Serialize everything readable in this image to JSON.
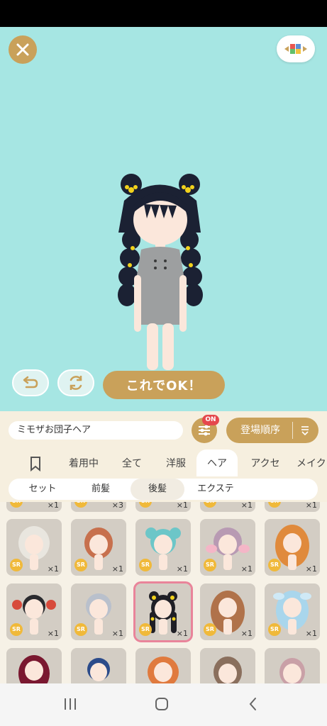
{
  "header": {
    "close_icon": "close-icon",
    "palette_icon": "palette-icon"
  },
  "avatar": {
    "hair_color": "#1b2133",
    "flower_color": "#f2d21c",
    "outfit_color": "#9d9fa0"
  },
  "controls": {
    "undo_icon": "undo-icon",
    "rotate_icon": "rotate-icon",
    "ok_label": "これでOK！"
  },
  "search": {
    "item_name": "ミモザお団子ヘア",
    "filter_badge": "ON",
    "sort_label": "登場順序"
  },
  "tabs": [
    {
      "label": ""
    },
    {
      "label": "着用中"
    },
    {
      "label": "全て"
    },
    {
      "label": "洋服"
    },
    {
      "label": "ヘア"
    },
    {
      "label": "アクセ"
    },
    {
      "label": "メイク"
    }
  ],
  "subtabs": [
    {
      "label": "セット"
    },
    {
      "label": "前髪"
    },
    {
      "label": "後髪"
    },
    {
      "label": "エクステ"
    }
  ],
  "grid": {
    "row0": [
      {
        "count": "×1"
      },
      {
        "count": "×3"
      },
      {
        "count": "×1"
      },
      {
        "count": "×1"
      },
      {
        "count": "×1"
      }
    ],
    "row1": [
      {
        "rarity": "SR",
        "count": "×1",
        "hair": "#e9e6df"
      },
      {
        "rarity": "SR",
        "count": "×1",
        "hair": "#c7704d"
      },
      {
        "rarity": "SR",
        "count": "×1",
        "hair": "#6cc6c8"
      },
      {
        "rarity": "SR",
        "count": "×1",
        "hair": "#b89ab3"
      },
      {
        "rarity": "SR",
        "count": "×1",
        "hair": "#e08a3c"
      }
    ],
    "row2": [
      {
        "rarity": "SR",
        "count": "×1",
        "hair": "#2a2a2e"
      },
      {
        "rarity": "SR",
        "count": "×1",
        "hair": "#b9c0cc"
      },
      {
        "rarity": "SR",
        "count": "×1",
        "hair": "#1f1f26"
      },
      {
        "rarity": "SR",
        "count": "×1",
        "hair": "#b0724a"
      },
      {
        "rarity": "SR",
        "count": "×1",
        "hair": "#a9d6ec"
      }
    ],
    "row3": [
      {
        "hair": "#7a1830"
      },
      {
        "hair": "#2b4b8a"
      },
      {
        "hair": "#e07a3e"
      },
      {
        "hair": "#8a6f5d"
      },
      {
        "hair": "#c9a0a7"
      }
    ]
  },
  "nav": {
    "recent_icon": "recent-apps-icon",
    "home_icon": "home-icon",
    "back_icon": "back-icon"
  }
}
